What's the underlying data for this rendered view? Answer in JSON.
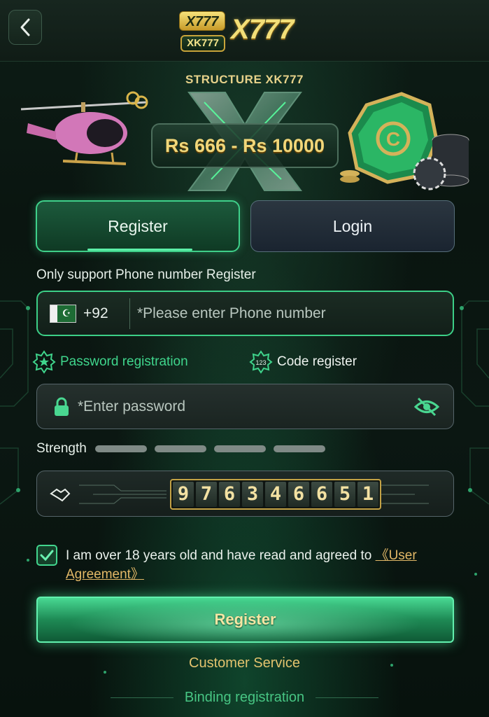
{
  "header": {
    "logo_small_top": "X777",
    "logo_small_bottom": "XK777",
    "logo_big": "X777"
  },
  "banner": {
    "title": "STRUCTURE XK777",
    "amount": "Rs 666 - Rs 10000"
  },
  "tabs": [
    {
      "label": "Register",
      "active": true
    },
    {
      "label": "Login",
      "active": false
    }
  ],
  "form": {
    "support_text": "Only support Phone number Register",
    "country_code": "+92",
    "phone_placeholder": "*Please enter Phone number",
    "modes": {
      "password": "Password registration",
      "code": "Code register",
      "code_icon_text": "123"
    },
    "password_placeholder": "*Enter password",
    "strength_label": "Strength",
    "captcha_digits": [
      "9",
      "7",
      "6",
      "3",
      "4",
      "6",
      "6",
      "5",
      "1"
    ],
    "agree_text": "I am over 18 years old and have read and agreed to ",
    "agree_link": "《User Agreement》",
    "agree_checked": true,
    "register_button": "Register"
  },
  "footer": {
    "customer_service": "Customer Service",
    "binding_registration": "Binding registration"
  },
  "colors": {
    "accent_green": "#3fd58c",
    "gold": "#e2c36e"
  }
}
